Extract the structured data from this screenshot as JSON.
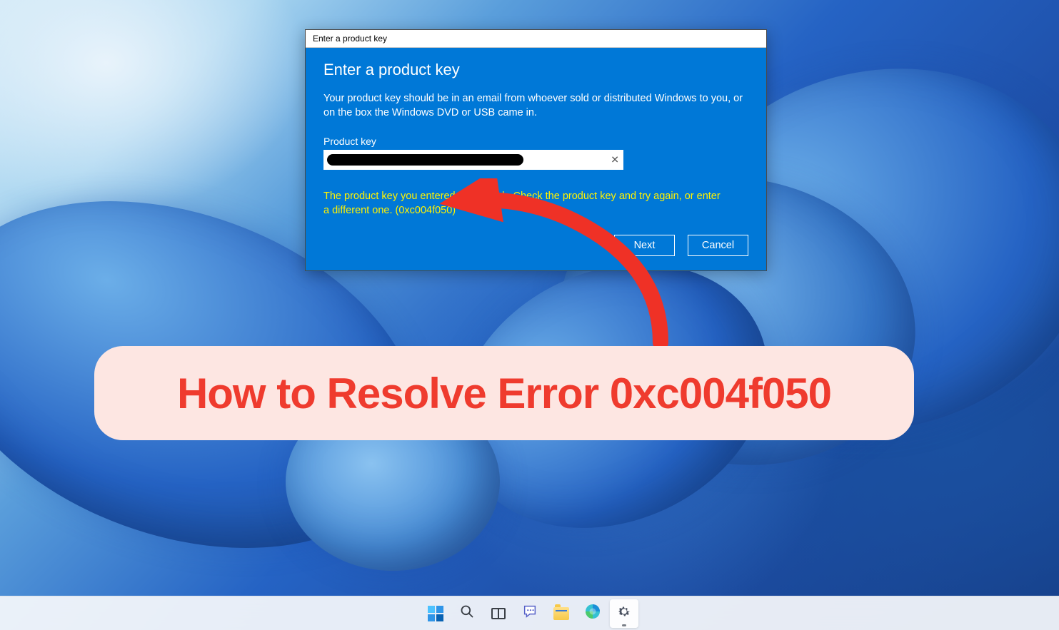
{
  "dialog": {
    "title": "Enter a product key",
    "heading": "Enter a product key",
    "description": "Your product key should be in an email from whoever sold or distributed Windows to you, or on the box the Windows DVD or USB came in.",
    "field_label": "Product key",
    "clear_glyph": "✕",
    "error": "The product key you entered didn't work. Check the product key and try again, or enter a different one. (0xc004f050)",
    "next_label": "Next",
    "cancel_label": "Cancel"
  },
  "caption": "How to Resolve Error 0xc004f050",
  "taskbar": {
    "start": "Start",
    "search": "Search",
    "taskview": "Task View",
    "chat": "Chat",
    "explorer": "File Explorer",
    "edge": "Microsoft Edge",
    "settings": "Settings"
  },
  "colors": {
    "dialog_bg": "#0078d7",
    "error_text": "#fff200",
    "caption_bg": "#fde6e2",
    "caption_text": "#ef3b2e",
    "arrow": "#ef3126"
  }
}
